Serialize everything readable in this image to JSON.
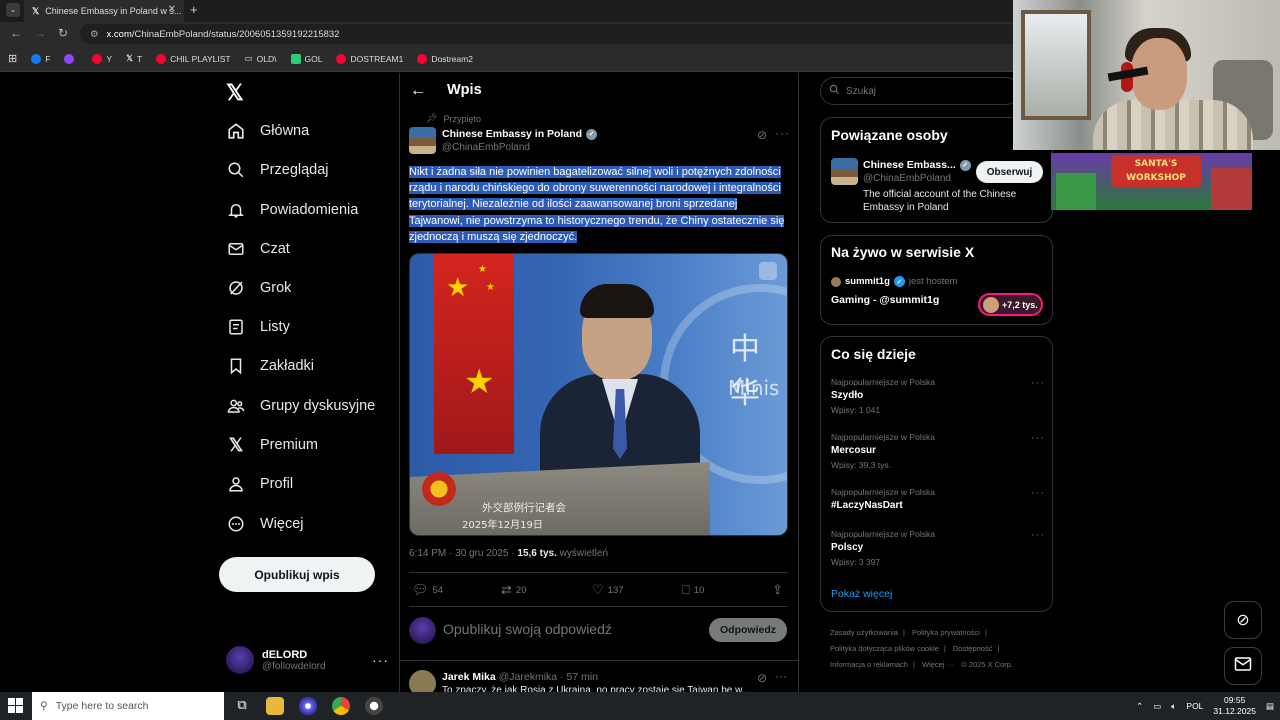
{
  "browser": {
    "tab_title": "Chinese Embassy in Poland w s...",
    "url_host": "x.com",
    "url_path": "/ChinaEmbPoland/status/2006051359192215832",
    "bookmarks": [
      {
        "label": "F",
        "color": "#1877f2"
      },
      {
        "label": "",
        "color": "#9146ff"
      },
      {
        "label": "Y",
        "color": "#ff0033"
      },
      {
        "label": "T",
        "color": "#ffffff"
      },
      {
        "label": "CHIL PLAYLIST",
        "color": "#ff0033"
      },
      {
        "label": "OLD\\",
        "color": "#cccccc"
      },
      {
        "label": "GOL",
        "color": "#2ecc71"
      },
      {
        "label": "DOSTREAM1",
        "color": "#ff0033"
      },
      {
        "label": "Dostream2",
        "color": "#ff0033"
      }
    ]
  },
  "nav": {
    "items": [
      {
        "label": "Główna",
        "icon": "home-icon"
      },
      {
        "label": "Przeglądaj",
        "icon": "search-icon"
      },
      {
        "label": "Powiadomienia",
        "icon": "bell-icon"
      },
      {
        "label": "Czat",
        "icon": "mail-icon"
      },
      {
        "label": "Grok",
        "icon": "grok-icon"
      },
      {
        "label": "Listy",
        "icon": "list-icon"
      },
      {
        "label": "Zakładki",
        "icon": "bookmark-icon"
      },
      {
        "label": "Grupy dyskusyjne",
        "icon": "people-icon"
      },
      {
        "label": "Premium",
        "icon": "x-icon"
      },
      {
        "label": "Profil",
        "icon": "person-icon"
      },
      {
        "label": "Więcej",
        "icon": "more-circle-icon"
      }
    ],
    "post_button": "Opublikuj wpis",
    "account": {
      "name": "dELORD",
      "handle": "@followdelord"
    }
  },
  "header": {
    "title": "Wpis"
  },
  "tweet": {
    "pinned_label": "Przypięto",
    "author": "Chinese Embassy in Poland",
    "handle": "@ChinaEmbPoland",
    "text": "Nikt i żadna siła nie powinien bagatelizować silnej woli i potężnych zdolności rządu i narodu chińskiego do obrony suwerenności narodowej i integralności terytorialnej. Niezależnie od ilości zaawansowanej broni sprzedanej Tajwanowi, nie powstrzyma to historycznego trendu, że Chiny ostatecznie się zjednoczą i muszą się zjednoczyć.",
    "image_text": {
      "banner": "中华",
      "banner2": "Minis",
      "caption1": "外交部例行记者会",
      "caption2": "2025年12月19日"
    },
    "time": "6:14 PM · 30 gru 2025 · ",
    "views_value": "15,6 tys.",
    "views_label": " wyświetleń",
    "replies": "54",
    "reposts": "20",
    "likes": "137",
    "bookmarks": "10"
  },
  "reply_box": {
    "placeholder": "Opublikuj swoją odpowiedź",
    "button": "Odpowiedz"
  },
  "reply": {
    "name": "Jarek Mika",
    "handle": "@Jarekmika · 57 min",
    "text": "To znaczy, że jak Rosja z Ukrainą, no pracy zostaje się Tajwan be w..."
  },
  "search": {
    "placeholder": "Szukaj"
  },
  "related": {
    "title": "Powiązane osoby",
    "name": "Chinese Embass...",
    "handle": "@ChinaEmbPoland",
    "bio": "The official account of the Chinese Embassy in Poland",
    "follow": "Obserwuj"
  },
  "live": {
    "title": "Na żywo w serwisie X",
    "host": "summit1g",
    "host_suffix": "jest hostem",
    "stream": "Gaming - @summit1g",
    "count": "+7,2 tys."
  },
  "trends": {
    "title": "Co się dzieje",
    "items": [
      {
        "context": "Najpopularniejsze w Polska",
        "topic": "Szydło",
        "posts": "Wpisy: 1 041"
      },
      {
        "context": "Najpopularniejsze w Polska",
        "topic": "Mercosur",
        "posts": "Wpisy: 39,3 tys."
      },
      {
        "context": "Najpopularniejsze w Polska",
        "topic": "#LaczyNasDart",
        "posts": ""
      },
      {
        "context": "Najpopularniejsze w Polska",
        "topic": "Polscy",
        "posts": "Wpisy: 3 397"
      }
    ],
    "show_more": "Pokaż więcej"
  },
  "footer": [
    "Zasady użytkowania",
    "|",
    "Polityka prywatności",
    "|",
    "Polityka dotycząca plików cookie",
    "|",
    "Dostępność",
    "|",
    "Informacja o reklamach",
    "|",
    "Więcej ···",
    "© 2025 X Corp."
  ],
  "overlay": {
    "banner_text": "SANTA'S WORKSHOP"
  },
  "taskbar": {
    "search_placeholder": "Type here to search",
    "lang": "POL",
    "time": "09:55",
    "date": "31.12.2025"
  }
}
